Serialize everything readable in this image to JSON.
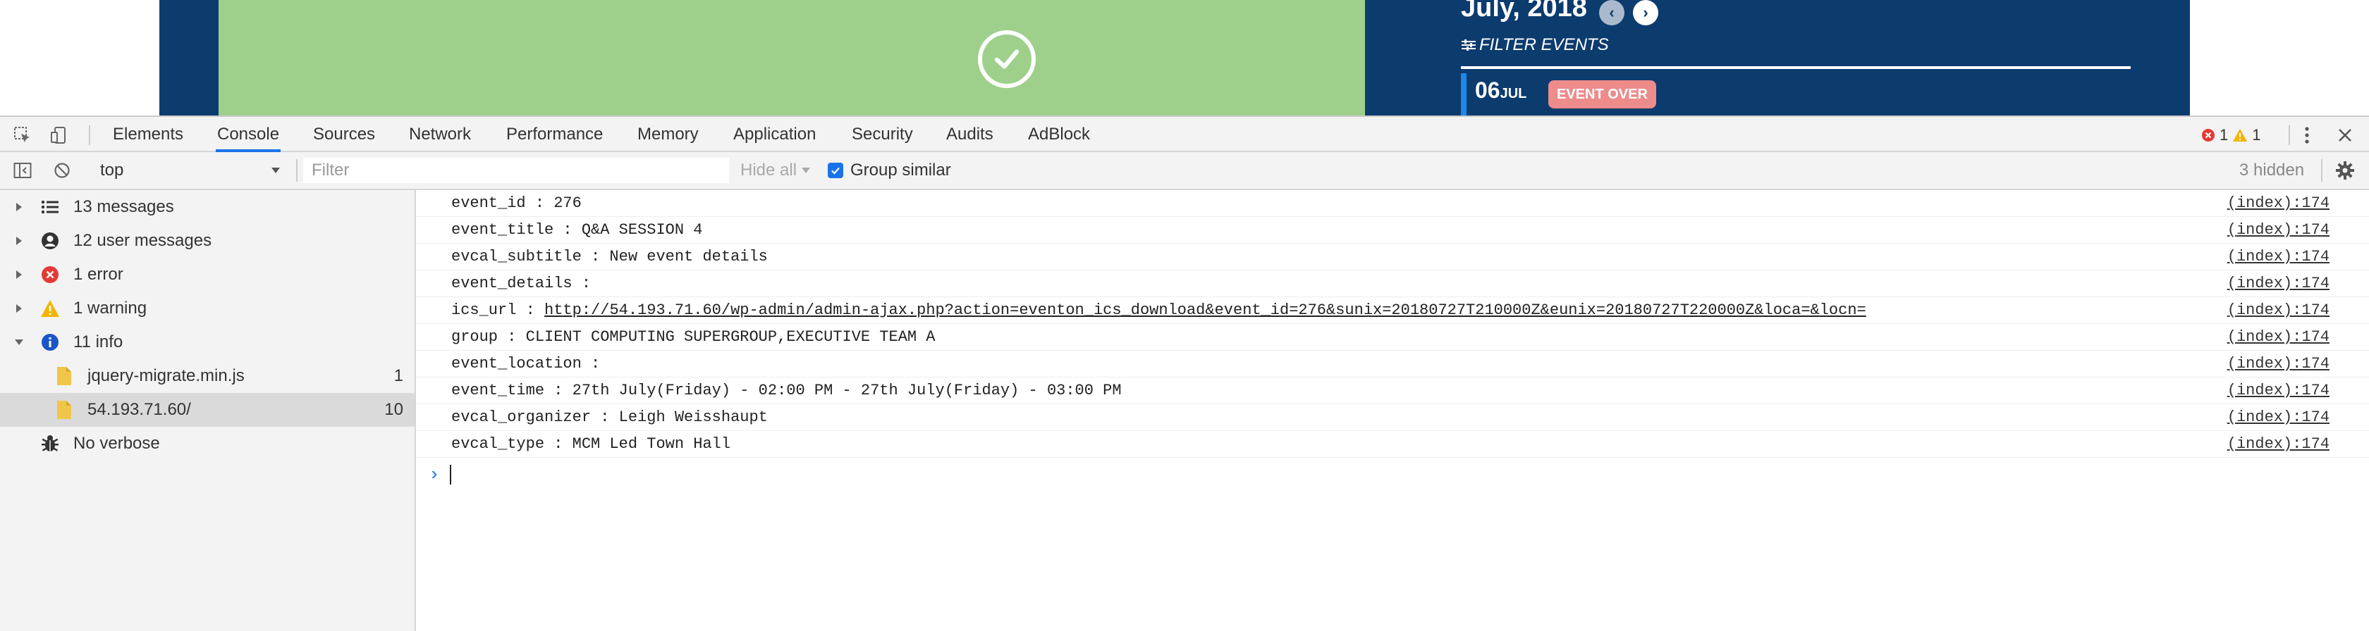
{
  "page_preview": {
    "calendar_title": "July, 2018",
    "filter_events_label": "FILTER EVENTS",
    "event_day": "06",
    "event_month": "JUL",
    "event_badge": "EVENT OVER",
    "colors": {
      "strip": "#0c3b6e",
      "green_panel": "#9ed08c",
      "badge": "#ee8b8b"
    }
  },
  "devtools": {
    "tabs": [
      "Elements",
      "Console",
      "Sources",
      "Network",
      "Performance",
      "Memory",
      "Application",
      "Security",
      "Audits",
      "AdBlock"
    ],
    "active_tab": "Console",
    "error_count": "1",
    "warning_count": "1",
    "toolbar": {
      "context": "top",
      "filter_placeholder": "Filter",
      "hide_all": "Hide all",
      "group_similar": "Group similar",
      "hidden_count": "3 hidden"
    },
    "sidebar": [
      {
        "label": "13 messages",
        "icon": "list-icon",
        "expanded": false
      },
      {
        "label": "12 user messages",
        "icon": "user-icon",
        "expanded": false
      },
      {
        "label": "1 error",
        "icon": "error-icon",
        "expanded": false
      },
      {
        "label": "1 warning",
        "icon": "warning-icon",
        "expanded": false
      },
      {
        "label": "11 info",
        "icon": "info-icon",
        "expanded": true
      },
      {
        "label": "jquery-migrate.min.js",
        "icon": "file-icon",
        "count": "1"
      },
      {
        "label": "54.193.71.60/",
        "icon": "file-icon",
        "count": "10",
        "selected": true
      },
      {
        "label": "No verbose",
        "icon": "bug-icon"
      }
    ],
    "console_rows": [
      {
        "message": "event_id : 276",
        "source": "(index):174"
      },
      {
        "message": "event_title : Q&A SESSION 4",
        "source": "(index):174"
      },
      {
        "message": "evcal_subtitle : New event details",
        "source": "(index):174"
      },
      {
        "message": "event_details : ",
        "source": "(index):174"
      },
      {
        "message": "ics_url : ",
        "link": "http://54.193.71.60/wp-admin/admin-ajax.php?action=eventon_ics_download&event_id=276&sunix=20180727T210000Z&eunix=20180727T220000Z&loca=&locn=",
        "source": "(index):174"
      },
      {
        "message": "group : CLIENT COMPUTING SUPERGROUP,EXECUTIVE TEAM A",
        "source": "(index):174"
      },
      {
        "message": "event_location : ",
        "source": "(index):174"
      },
      {
        "message": "event_time : 27th July(Friday) - 02:00 PM - 27th July(Friday) - 03:00 PM",
        "source": "(index):174"
      },
      {
        "message": "evcal_organizer : Leigh Weisshaupt",
        "source": "(index):174"
      },
      {
        "message": "evcal_type : MCM Led Town Hall",
        "source": "(index):174"
      }
    ],
    "prompt_symbol": "›"
  }
}
